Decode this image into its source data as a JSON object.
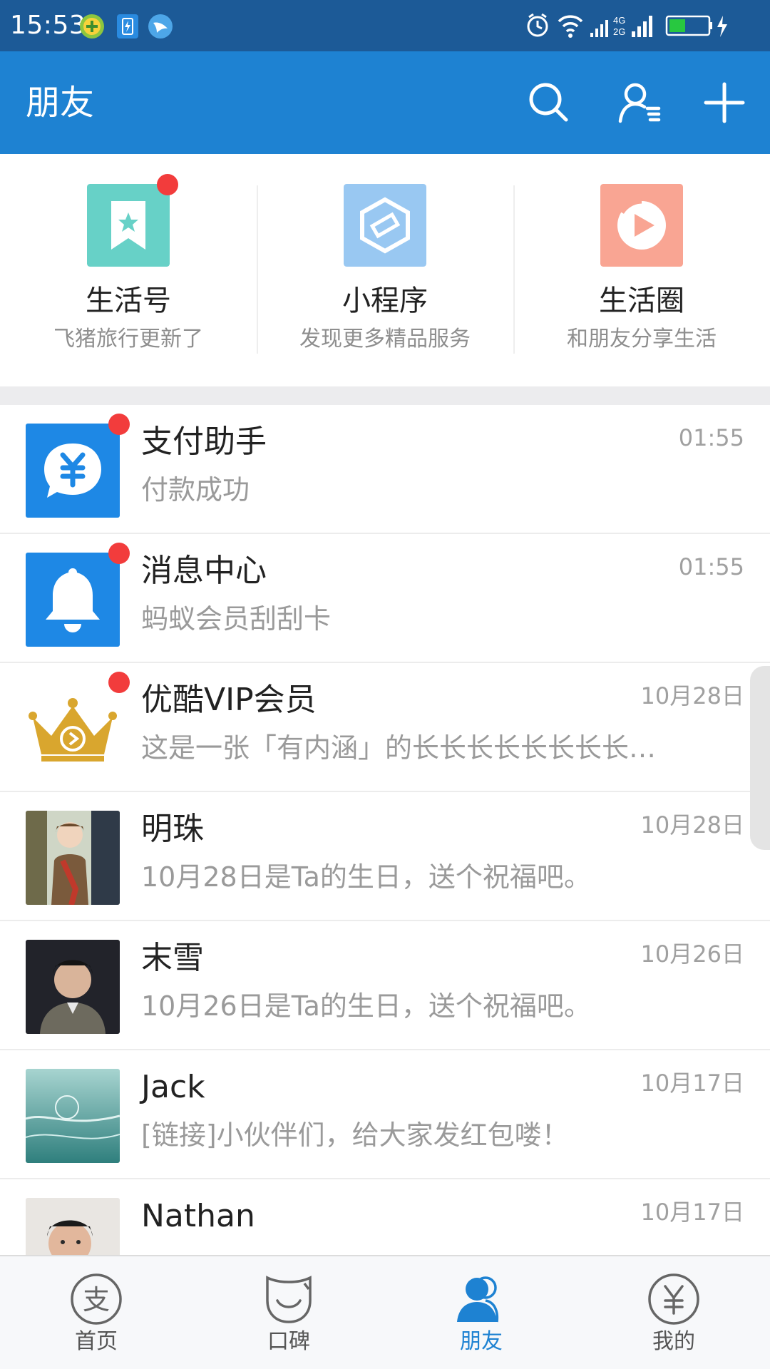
{
  "status_bar": {
    "time": "15:53",
    "network_top": "4G",
    "network_bottom": "2G",
    "icons": [
      "notification-icon",
      "battery-saver-icon",
      "bird-icon",
      "alarm-icon",
      "wifi-icon",
      "signal-icon",
      "battery-icon",
      "charging-icon"
    ]
  },
  "header": {
    "title": "朋友",
    "actions": [
      "search-icon",
      "contacts-icon",
      "add-icon"
    ]
  },
  "quick_entries": [
    {
      "title": "生活号",
      "subtitle": "飞猪旅行更新了",
      "icon": "bookmark-star-icon",
      "color": "#67d1c7",
      "badge": true
    },
    {
      "title": "小程序",
      "subtitle": "发现更多精品服务",
      "icon": "mini-program-icon",
      "color": "#99c8f2",
      "badge": false
    },
    {
      "title": "生活圈",
      "subtitle": "和朋友分享生活",
      "icon": "life-circle-icon",
      "color": "#f9a593",
      "badge": false
    }
  ],
  "conversations": [
    {
      "name": "支付助手",
      "message": "付款成功",
      "time": "01:55",
      "badge": true,
      "avatar": "payment-assistant-icon"
    },
    {
      "name": "消息中心",
      "message": "蚂蚁会员刮刮卡",
      "time": "01:55",
      "badge": true,
      "avatar": "bell-icon"
    },
    {
      "name": "优酷VIP会员",
      "message": "这是一张「有内涵」的长长长长长长长长…",
      "time": "10月28日",
      "badge": true,
      "avatar": "crown-icon"
    },
    {
      "name": "明珠",
      "message": "10月28日是Ta的生日，送个祝福吧。",
      "time": "10月28日",
      "badge": false,
      "avatar": "user-photo"
    },
    {
      "name": "末雪",
      "message": "10月26日是Ta的生日，送个祝福吧。",
      "time": "10月26日",
      "badge": false,
      "avatar": "user-photo"
    },
    {
      "name": "Jack",
      "message": "[链接]小伙伴们，给大家发红包喽！",
      "time": "10月17日",
      "badge": false,
      "avatar": "user-photo"
    },
    {
      "name": "Nathan",
      "message": "",
      "time": "10月17日",
      "badge": false,
      "avatar": "user-photo"
    }
  ],
  "tabs": [
    {
      "label": "首页",
      "icon": "home-icon",
      "active": false
    },
    {
      "label": "口碑",
      "icon": "koubei-icon",
      "active": false
    },
    {
      "label": "朋友",
      "icon": "friends-icon",
      "active": true
    },
    {
      "label": "我的",
      "icon": "yuan-icon",
      "active": false
    }
  ],
  "colors": {
    "status_bar": "#1c5a97",
    "header": "#1e82d2",
    "badge": "#f23c3c",
    "active_tab": "#1e82d2"
  }
}
